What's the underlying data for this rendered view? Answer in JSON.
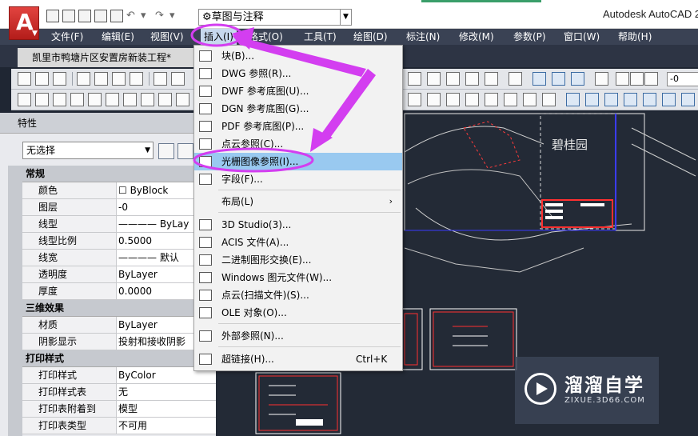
{
  "window": {
    "app_title": "Autodesk AutoCAD 2",
    "workspace": "草图与注释",
    "document_tab": "凯里市鸭塘片区安置房新装工程*"
  },
  "menubar": {
    "items": [
      "文件(F)",
      "编辑(E)",
      "视图(V)",
      "插入(I)",
      "格式(O)",
      "工具(T)",
      "绘图(D)",
      "标注(N)",
      "修改(M)",
      "参数(P)",
      "窗口(W)",
      "帮助(H)"
    ]
  },
  "toolbar": {
    "layer_value": "-0"
  },
  "properties": {
    "header": "特性",
    "selection": "无选择",
    "categories": [
      {
        "name": "常规",
        "rows": [
          {
            "name": "颜色",
            "value": "ByBlock"
          },
          {
            "name": "图层",
            "value": "-0"
          },
          {
            "name": "线型",
            "value": "———— ByLay"
          },
          {
            "name": "线型比例",
            "value": "0.5000"
          },
          {
            "name": "线宽",
            "value": "———— 默认"
          },
          {
            "name": "透明度",
            "value": "ByLayer"
          },
          {
            "name": "厚度",
            "value": "0.0000"
          }
        ]
      },
      {
        "name": "三维效果",
        "rows": [
          {
            "name": "材质",
            "value": "ByLayer"
          },
          {
            "name": "阴影显示",
            "value": "投射和接收阴影"
          }
        ]
      },
      {
        "name": "打印样式",
        "rows": [
          {
            "name": "打印样式",
            "value": "ByColor"
          },
          {
            "name": "打印样式表",
            "value": "无"
          },
          {
            "name": "打印表附着到",
            "value": "模型"
          },
          {
            "name": "打印表类型",
            "value": "不可用"
          }
        ]
      }
    ]
  },
  "insert_menu": {
    "items": [
      {
        "label": "块(B)...",
        "icon": "block-icon"
      },
      {
        "label": "DWG 参照(R)...",
        "icon": "dwg-icon"
      },
      {
        "label": "DWF 参考底图(U)...",
        "icon": "dwf-icon"
      },
      {
        "label": "DGN 参考底图(G)...",
        "icon": "dgn-icon"
      },
      {
        "label": "PDF 参考底图(P)...",
        "icon": "pdf-icon"
      },
      {
        "label": "点云参照(C)...",
        "icon": "point-cloud-icon"
      },
      {
        "label": "光栅图像参照(I)...",
        "icon": "raster-image-icon",
        "highlighted": true
      },
      {
        "label": "字段(F)...",
        "icon": "field-icon"
      },
      {
        "label": "布局(L)",
        "icon": "",
        "submenu": "›"
      },
      {
        "label": "3D Studio(3)...",
        "icon": "3ds-icon"
      },
      {
        "label": "ACIS 文件(A)...",
        "icon": "acis-icon"
      },
      {
        "label": "二进制图形交换(E)...",
        "icon": "dxb-icon"
      },
      {
        "label": "Windows 图元文件(W)...",
        "icon": "wmf-icon"
      },
      {
        "label": "点云(扫描文件)(S)...",
        "icon": "scan-icon"
      },
      {
        "label": "OLE 对象(O)...",
        "icon": "ole-icon"
      },
      {
        "label": "外部参照(N)...",
        "icon": "xref-icon"
      },
      {
        "label": "超链接(H)...",
        "icon": "hyperlink-icon",
        "shortcut": "Ctrl+K"
      }
    ]
  },
  "canvas": {
    "label": "碧桂园"
  },
  "watermark": {
    "title": "溜溜自学",
    "url": "ZIXUE.3D66.COM"
  },
  "colors": {
    "accent": "#d33ef0",
    "highlight": "#99c9f0",
    "canvas": "#232a36"
  }
}
